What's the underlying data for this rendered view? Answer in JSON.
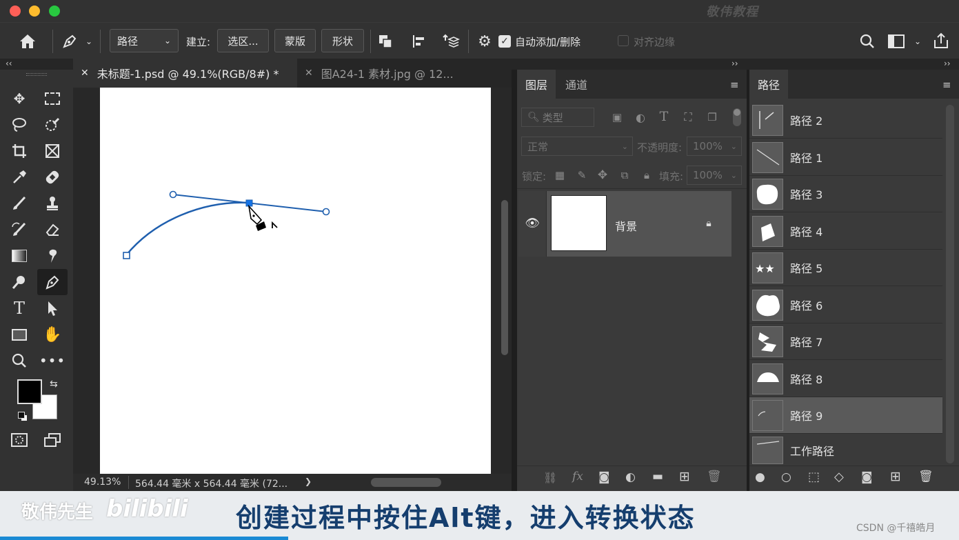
{
  "watermark_top": "敬伟教程",
  "options": {
    "mode_select": "路径",
    "make_label": "建立:",
    "selection_btn": "选区...",
    "mask_btn": "蒙版",
    "shape_btn": "形状",
    "auto_add_label": "自动添加/删除",
    "align_edges_label": "对齐边缘"
  },
  "doc_tabs": [
    {
      "title": "未标题-1.psd @ 49.1%(RGB/8#) *",
      "active": true
    },
    {
      "title": "图A24-1 素材.jpg @ 12...",
      "active": false
    }
  ],
  "status": {
    "zoom": "49.13%",
    "size": "564.44 毫米 x 564.44 毫米 (72...",
    "arrow": "❯"
  },
  "layers_panel": {
    "tabs": [
      "图层",
      "通道"
    ],
    "filter_placeholder": "类型",
    "blend_mode": "正常",
    "opacity_label": "不透明度:",
    "opacity_value": "100%",
    "lock_label": "锁定:",
    "fill_label": "填充:",
    "fill_value": "100%",
    "layers": [
      {
        "name": "背景",
        "locked": true
      }
    ]
  },
  "paths_panel": {
    "tab": "路径",
    "items": [
      "路径 2",
      "路径 1",
      "路径 3",
      "路径 4",
      "路径 5",
      "路径 6",
      "路径 7",
      "路径 8",
      "路径 9",
      "工作路径"
    ],
    "selected": "路径 9"
  },
  "subtitle_band": {
    "channel_name": "敬伟先生",
    "platform_logo": "bilibili",
    "caption": "创建过程中按住Alt键，进入转换状态",
    "credit": "CSDN @千禧皓月"
  },
  "colors": {
    "accent": "#1473e6",
    "path_line": "#1f5fae",
    "caption": "#153e6e"
  }
}
